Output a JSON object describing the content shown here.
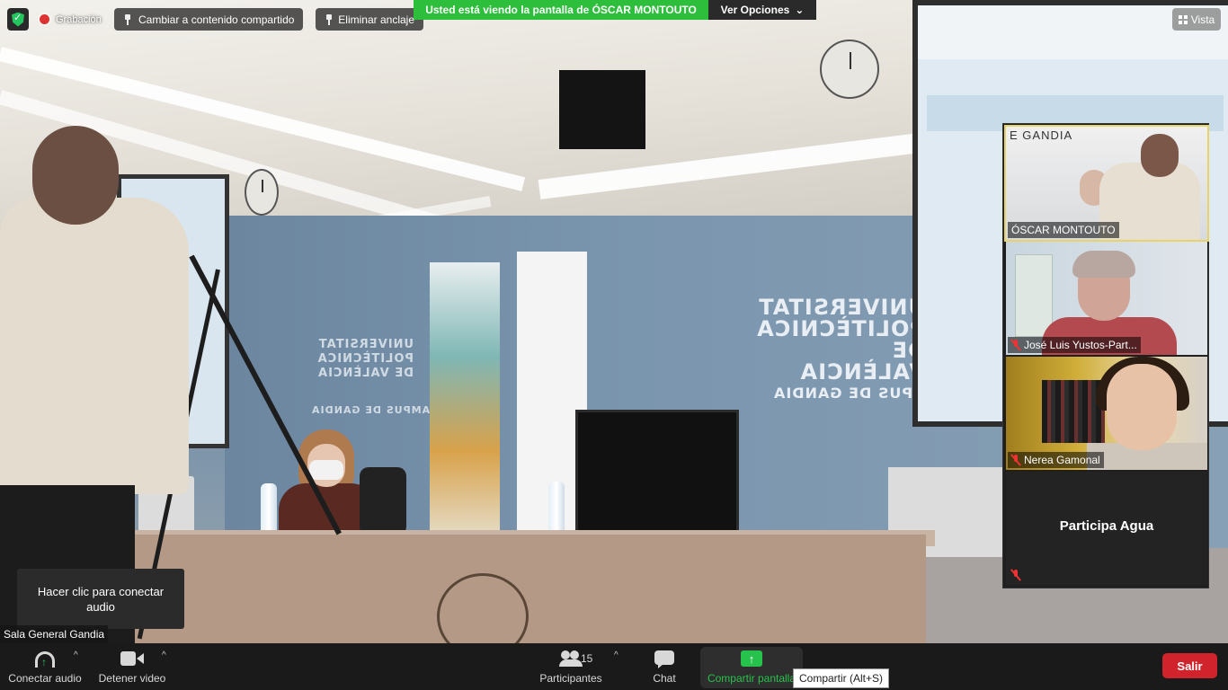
{
  "topbar": {
    "recording_label": "Grabación",
    "switch_shared_label": "Cambiar a contenido compartido",
    "unpin_label": "Eliminar anclaje",
    "view_label": "Vista"
  },
  "share_banner": {
    "text": "Usted está viendo la pantalla de ÓSCAR MONTOUTO",
    "options_label": "Ver Opciones"
  },
  "participants_strip": [
    {
      "name": "ÓSCAR MONTOUTO",
      "muted": false
    },
    {
      "name": "José Luis Yustos-Part...",
      "muted": true
    },
    {
      "name": "Nerea Gamonal",
      "muted": true
    },
    {
      "name": "Participa Agua",
      "muted": true
    }
  ],
  "scene": {
    "wall_logo_right": "UNIVERSITAT POLITÈCNICA DE VALÈNCIA",
    "wall_campus_right": "CAMPUS DE GANDIA",
    "tile1_logo": "E GANDIA"
  },
  "audio_popup": {
    "text": "Hacer clic para conectar audio"
  },
  "room_label": "Sala General Gandia",
  "toolbar": {
    "join_audio": "Conectar audio",
    "stop_video": "Detener video",
    "participants": "Participantes",
    "participants_count": "15",
    "chat": "Chat",
    "share_screen": "Compartir pantalla",
    "share_tooltip": "Compartir (Alt+S)",
    "leave": "Salir"
  },
  "colors": {
    "accent_green": "#2dbe3b",
    "leave_red": "#d1232b",
    "muted_red": "#e33333"
  }
}
